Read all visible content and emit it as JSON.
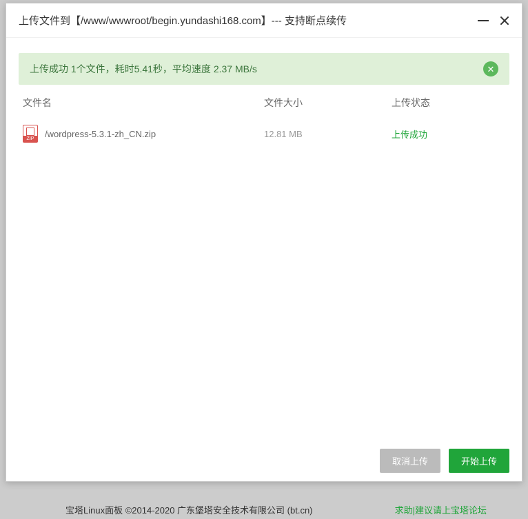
{
  "backdrop": {
    "copyright": "宝塔Linux面板 ©2014-2020 广东堡塔安全技术有限公司 (bt.cn)",
    "link": "求助|建议请上宝塔论坛"
  },
  "dialog": {
    "title": "上传文件到【/www/wwwroot/begin.yundashi168.com】--- 支持断点续传"
  },
  "success": {
    "message": "上传成功 1个文件，耗时5.41秒，平均速度 2.37 MB/s",
    "close_glyph": "✕"
  },
  "headers": {
    "name": "文件名",
    "size": "文件大小",
    "status": "上传状态"
  },
  "file": {
    "icon_label": "ZIP",
    "name": "/wordpress-5.3.1-zh_CN.zip",
    "size": "12.81 MB",
    "status": "上传成功"
  },
  "buttons": {
    "cancel": "取消上传",
    "start": "开始上传"
  }
}
